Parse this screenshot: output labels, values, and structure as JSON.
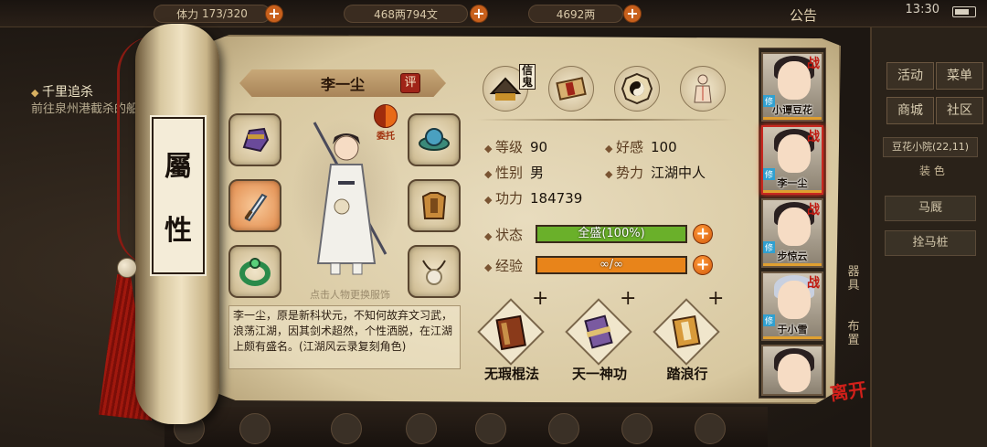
{
  "topbar": {
    "stamina_label": "体力",
    "stamina_value": "173/320",
    "money": "468两794文",
    "ingots": "4692两",
    "notice": "公告",
    "clock": "13:30"
  },
  "quest": {
    "title": "千里追杀",
    "desc": "前往泉州港截杀的船"
  },
  "right_panel": {
    "buttons": [
      "活动",
      "菜单",
      "商城",
      "社区"
    ],
    "location": "豆花小院(22,11)",
    "sub_label": "装 色",
    "wide_buttons": [
      "马厩",
      "拴马桩"
    ]
  },
  "scroll": {
    "label_chars": [
      "屬",
      "性"
    ]
  },
  "character": {
    "name": "李一尘",
    "review_label": "评",
    "delegate_label": "委托",
    "hint": "点击人物更换服饰",
    "bio": "李一尘，原是新科状元，不知何故弃文习武，浪荡江湖，因其剑术超然，个性洒脱，在江湖上颇有盛名。(江湖风云录复刻角色)",
    "letter_tag": "信鬼"
  },
  "equipment": [
    {
      "slot": "gloves",
      "icon": "gauntlet-icon",
      "highlight": false
    },
    {
      "slot": "hat",
      "icon": "hat-icon",
      "highlight": false
    },
    {
      "slot": "weapon",
      "icon": "sword-icon",
      "highlight": true
    },
    {
      "slot": "armor",
      "icon": "armor-icon",
      "highlight": false
    },
    {
      "slot": "ring",
      "icon": "ring-icon",
      "highlight": false
    },
    {
      "slot": "necklace",
      "icon": "necklace-icon",
      "highlight": false
    }
  ],
  "top_items": [
    "mount-hat-icon",
    "scroll-bundle-icon",
    "bagua-icon",
    "meridian-figure-icon"
  ],
  "stats": {
    "level_label": "等级",
    "level": "90",
    "favor_label": "好感",
    "favor": "100",
    "gender_label": "性别",
    "gender": "男",
    "faction_label": "势力",
    "faction": "江湖中人",
    "power_label": "功力",
    "power": "184739"
  },
  "bars": {
    "state_label": "状态",
    "state_text": "全盛(100%)",
    "state_fraction": 1.0,
    "state_color": "#6ab02a",
    "exp_label": "经验",
    "exp_text": "∞/∞",
    "exp_fraction": 1.0,
    "exp_color": "#e8841a"
  },
  "skills": [
    {
      "name": "无瑕棍法",
      "icon": "manual-icon"
    },
    {
      "name": "天一神功",
      "icon": "scroll-icon"
    },
    {
      "name": "踏浪行",
      "icon": "book-icon"
    }
  ],
  "skill_add_symbol": "+",
  "roster": [
    {
      "name": "小谭豆花",
      "war": "战",
      "tag": "修"
    },
    {
      "name": "李一尘",
      "war": "战",
      "tag": "修",
      "selected": true
    },
    {
      "name": "步惊云",
      "war": "战",
      "tag": "修"
    },
    {
      "name": "于小雪",
      "war": "战",
      "tag": "修"
    },
    {
      "name": "",
      "war": "",
      "tag": ""
    }
  ],
  "side_tabs": {
    "tab1": "器具",
    "tab2": "布置"
  },
  "leave_label": "离开",
  "bottom_icons": [
    "quest-icon",
    "bag-icon",
    "martial-icon",
    "bagua-icon",
    "layout-icon",
    "trade-icon",
    "letter-icon",
    "map-icon"
  ]
}
